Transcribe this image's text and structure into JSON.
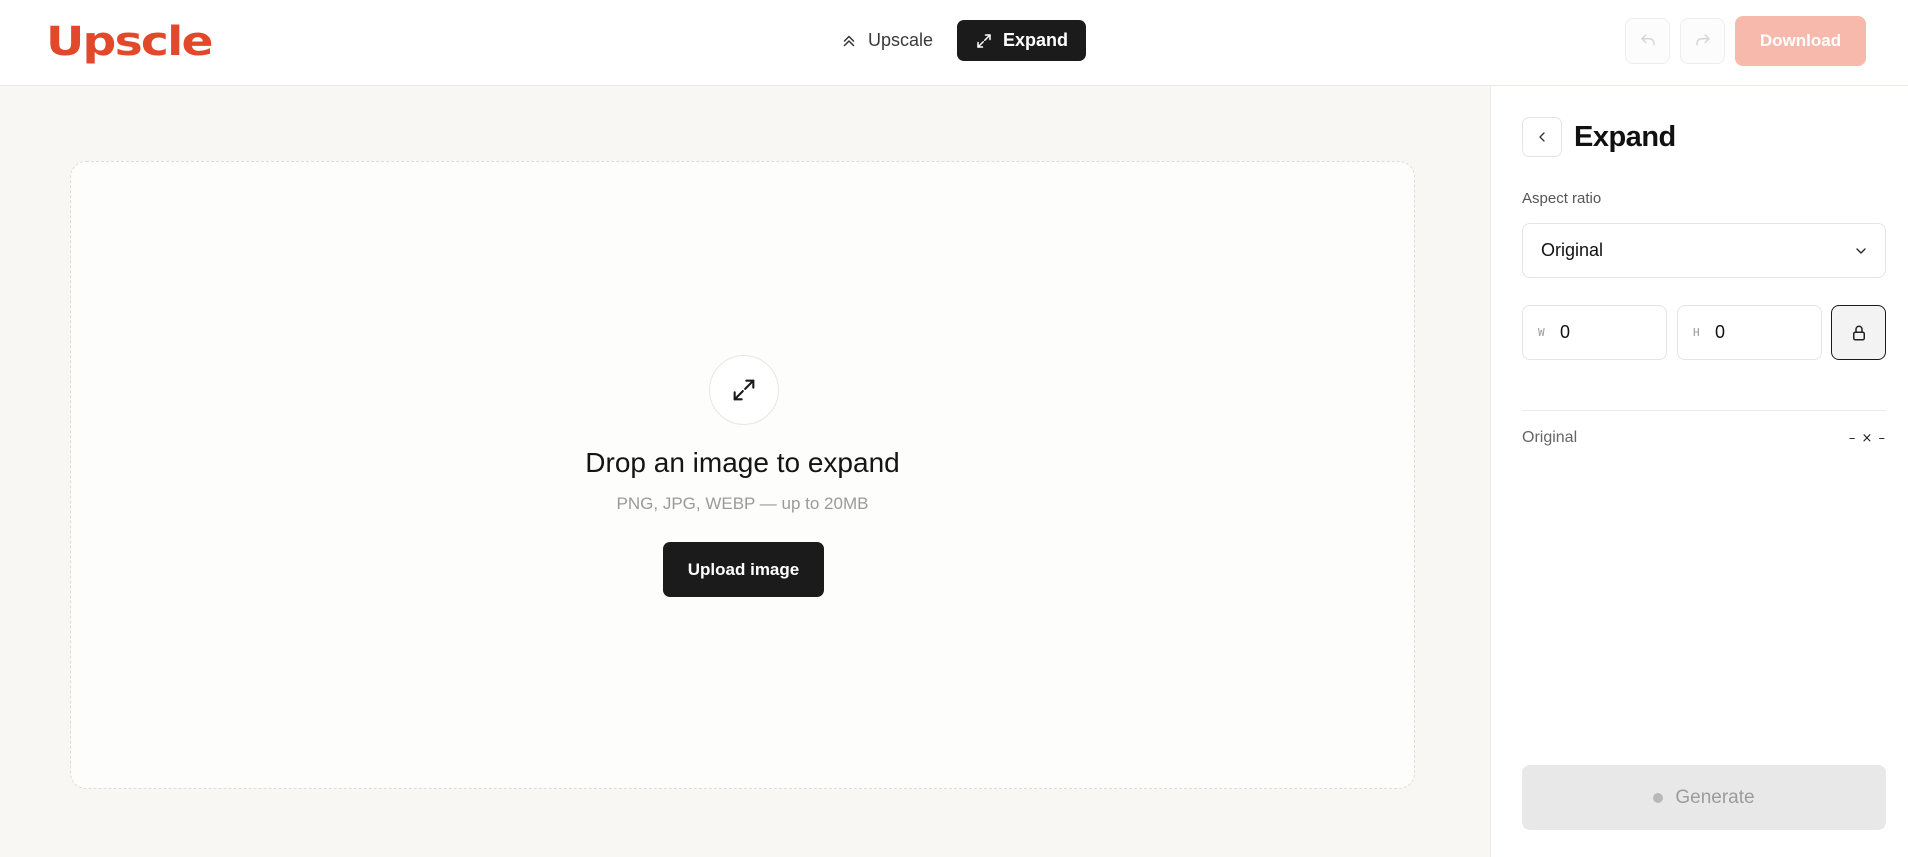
{
  "brand": {
    "logo_text": "Upscle",
    "accent": "#e2492a"
  },
  "header": {
    "modes": [
      {
        "label": "Upscale",
        "icon": "chevrons-up-icon",
        "active": false
      },
      {
        "label": "Expand",
        "icon": "expand-arrows-icon",
        "active": true
      }
    ],
    "undo_icon": "undo-icon",
    "redo_icon": "redo-icon",
    "download_label": "Download"
  },
  "dropzone": {
    "icon": "expand-arrows-icon",
    "title": "Drop an image to expand",
    "subtitle": "PNG, JPG, WEBP — up to 20MB",
    "upload_label": "Upload image"
  },
  "panel": {
    "title": "Expand",
    "aspect_label": "Aspect ratio",
    "aspect_value": "Original",
    "width_prefix": "W",
    "width_value": "0",
    "height_prefix": "H",
    "height_value": "0",
    "lock_icon": "lock-icon",
    "info_label": "Original",
    "info_value": "– × –",
    "generate_label": "Generate"
  }
}
